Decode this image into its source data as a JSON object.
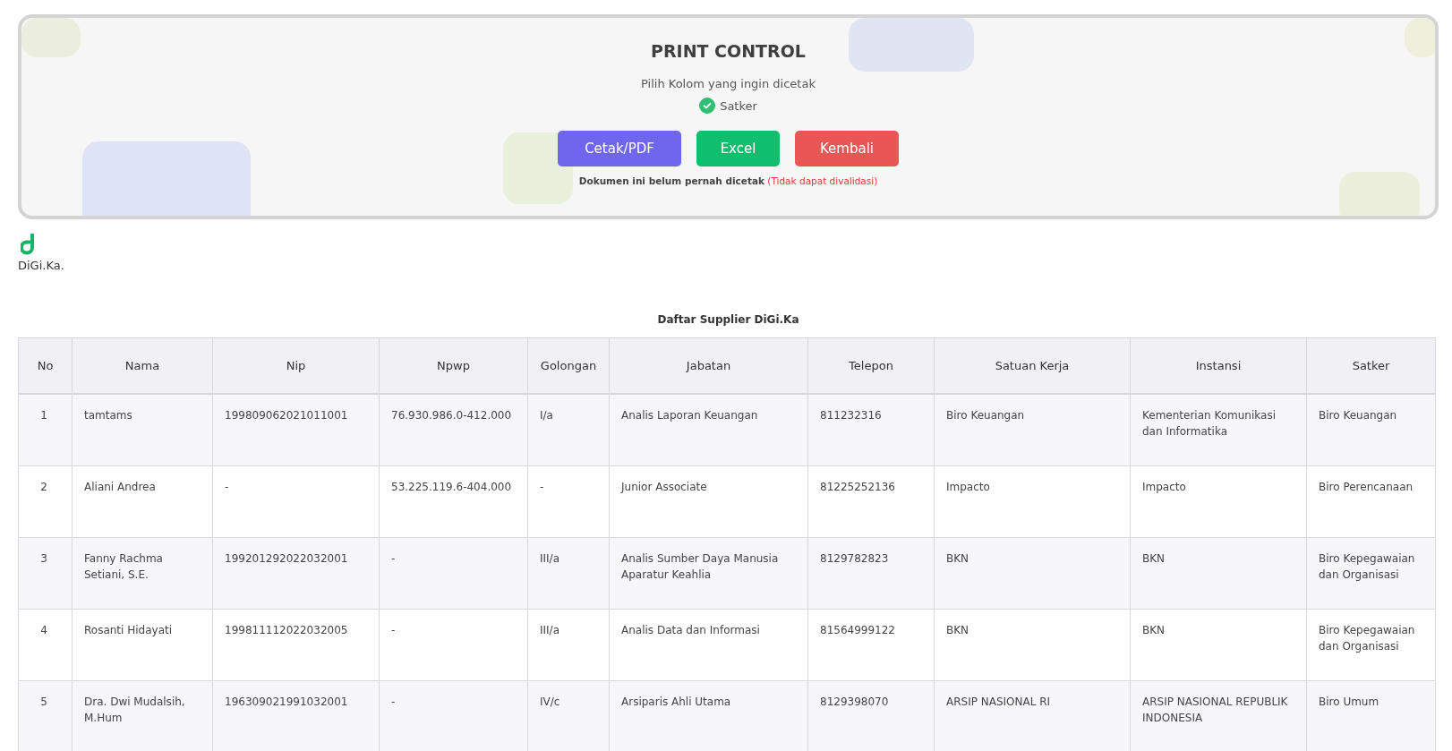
{
  "print_control": {
    "title": "PRINT CONTROL",
    "subtitle": "Pilih Kolom yang ingin dicetak",
    "columns": [
      {
        "label": "Satker",
        "checked": true
      }
    ],
    "buttons": [
      {
        "label": "Cetak/PDF",
        "kind": "pdf"
      },
      {
        "label": "Excel",
        "kind": "excel"
      },
      {
        "label": "Kembali",
        "kind": "back"
      }
    ],
    "notice": "Dokumen ini belum pernah dicetak",
    "warning": "(Tidak dapat divalidasi)"
  },
  "logo": {
    "text": "DiGi.Ka."
  },
  "table": {
    "title": "Daftar Supplier DiGi.Ka",
    "columns": [
      "No",
      "Nama",
      "Nip",
      "Npwp",
      "Golongan",
      "Jabatan",
      "Telepon",
      "Satuan Kerja",
      "Instansi",
      "Satker"
    ],
    "rows": [
      [
        "1",
        "tamtams",
        "199809062021011001",
        "76.930.986.0-412.000",
        "I/a",
        "Analis Laporan Keuangan",
        "811232316",
        "Biro Keuangan",
        "Kementerian Komunikasi dan Informatika",
        "Biro Keuangan"
      ],
      [
        "2",
        "Aliani Andrea",
        "-",
        "53.225.119.6-404.000",
        "-",
        "Junior Associate",
        "81225252136",
        "Impacto",
        "Impacto",
        "Biro Perencanaan"
      ],
      [
        "3",
        "Fanny Rachma Setiani, S.E.",
        "199201292022032001",
        "-",
        "III/a",
        "Analis Sumber Daya Manusia Aparatur Keahlia",
        "8129782823",
        "BKN",
        "BKN",
        "Biro Kepegawaian dan Organisasi"
      ],
      [
        "4",
        "Rosanti Hidayati",
        "199811112022032005",
        "-",
        "III/a",
        "Analis Data dan Informasi",
        "81564999122",
        "BKN",
        "BKN",
        "Biro Kepegawaian dan Organisasi"
      ],
      [
        "5",
        "Dra. Dwi Mudalsih, M.Hum",
        "196309021991032001",
        "-",
        "IV/c",
        "Arsiparis Ahli Utama",
        "8129398070",
        "ARSIP NASIONAL RI",
        "ARSIP NASIONAL REPUBLIK INDONESIA",
        "Biro Umum"
      ]
    ]
  }
}
